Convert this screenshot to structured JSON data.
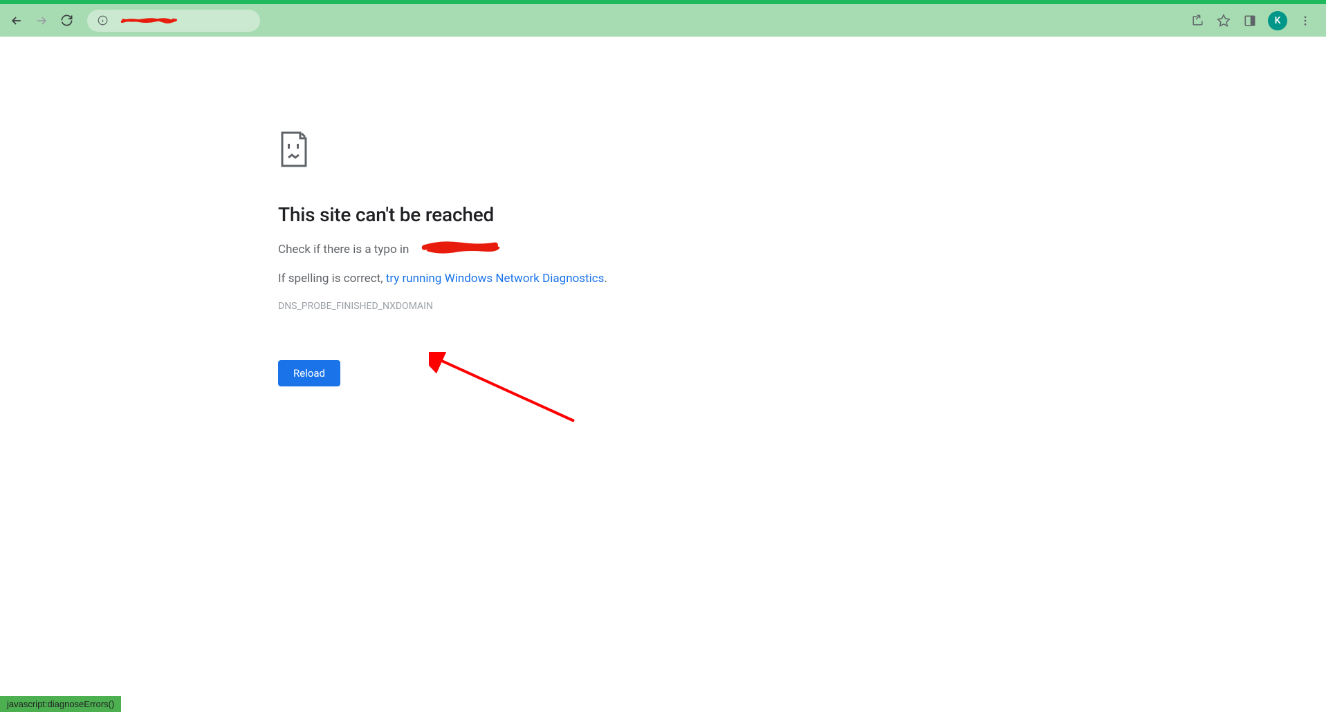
{
  "toolbar": {
    "url_visible_fragment": "",
    "avatar_letter": "K"
  },
  "error": {
    "title": "This site can't be reached",
    "line1_prefix": "Check if there is a typo in ",
    "line1_domain": "",
    "line2_prefix": "If spelling is correct, ",
    "diagnostics_link": "try running Windows Network Diagnostics",
    "line2_suffix": ".",
    "error_code": "DNS_PROBE_FINISHED_NXDOMAIN",
    "reload_label": "Reload"
  },
  "status_bar": {
    "text": "javascript:diagnoseErrors()"
  },
  "annotations": {
    "arrow_color": "#ff0000",
    "redaction_color": "#e81c0c"
  }
}
